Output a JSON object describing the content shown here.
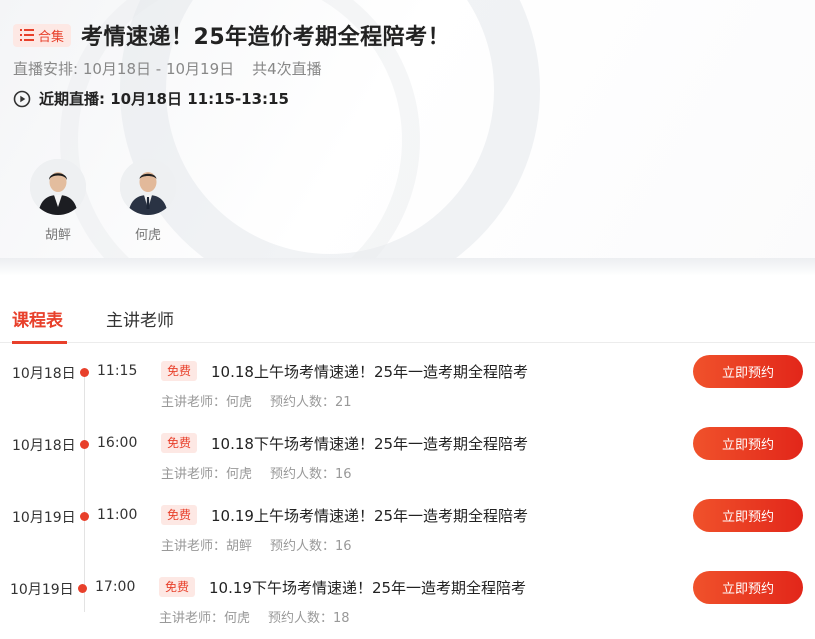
{
  "header": {
    "badge_label": "合集",
    "title": "考情速递！25年造价考期全程陪考！",
    "schedule_label": "直播安排: 10月18日 - 10月19日",
    "schedule_count": "共4次直播",
    "recent_label": "近期直播: 10月18日 11:15-13:15"
  },
  "teachers": [
    {
      "name": "胡鲆"
    },
    {
      "name": "何虎"
    }
  ],
  "tabs": [
    {
      "label": "课程表"
    },
    {
      "label": "主讲老师"
    }
  ],
  "sessions": [
    {
      "date": "10月18日",
      "time": "11:15",
      "tag": "免费",
      "title": "10.18上午场考情速递！25年一造考期全程陪考",
      "teacher": "主讲老师：何虎",
      "reservations": "预约人数：21",
      "button": "立即预约"
    },
    {
      "date": "10月18日",
      "time": "16:00",
      "tag": "免费",
      "title": "10.18下午场考情速递！25年一造考期全程陪考",
      "teacher": "主讲老师：何虎",
      "reservations": "预约人数：16",
      "button": "立即预约"
    },
    {
      "date": "10月19日",
      "time": "11:00",
      "tag": "免费",
      "title": "10.19上午场考情速递！25年一造考期全程陪考",
      "teacher": "主讲老师：胡鲆",
      "reservations": "预约人数：16",
      "button": "立即预约"
    },
    {
      "date": "10月19日",
      "time": "17:00",
      "tag": "免费",
      "title": "10.19下午场考情速递！25年一造考期全程陪考",
      "teacher": "主讲老师：何虎",
      "reservations": "预约人数：18",
      "button": "立即预约"
    }
  ],
  "colors": {
    "accent": "#e8402b",
    "badge_bg": "#fde8e4",
    "muted": "#999999"
  }
}
